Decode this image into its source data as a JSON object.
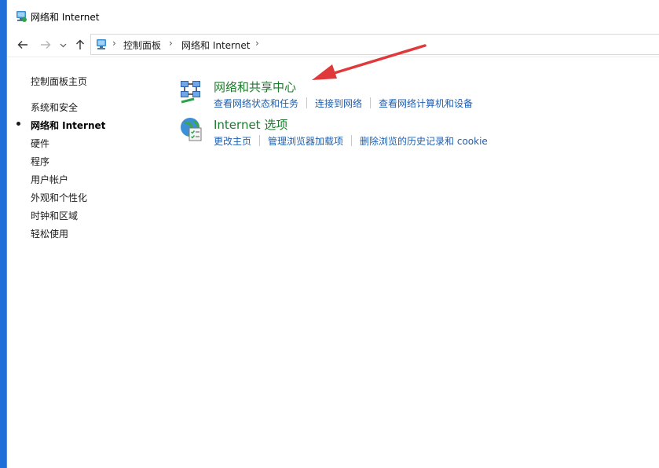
{
  "window": {
    "title": "网络和 Internet"
  },
  "nav": {
    "back_icon": "arrow-left-icon",
    "forward_icon": "arrow-right-icon",
    "recent_icon": "chevron-down-icon",
    "up_icon": "arrow-up-icon"
  },
  "breadcrumb": {
    "items": [
      "控制面板",
      "网络和 Internet"
    ]
  },
  "sidebar": {
    "home": "控制面板主页",
    "items": [
      {
        "label": "系统和安全",
        "active": false
      },
      {
        "label": "网络和 Internet",
        "active": true
      },
      {
        "label": "硬件",
        "active": false
      },
      {
        "label": "程序",
        "active": false
      },
      {
        "label": "用户帐户",
        "active": false
      },
      {
        "label": "外观和个性化",
        "active": false
      },
      {
        "label": "时钟和区域",
        "active": false
      },
      {
        "label": "轻松使用",
        "active": false
      }
    ]
  },
  "categories": [
    {
      "title": "网络和共享中心",
      "icon": "network-sharing-center-icon",
      "tasks": [
        "查看网络状态和任务",
        "连接到网络",
        "查看网络计算机和设备"
      ]
    },
    {
      "title": "Internet 选项",
      "icon": "internet-options-icon",
      "tasks": [
        "更改主页",
        "管理浏览器加载项",
        "删除浏览的历史记录和 cookie"
      ]
    }
  ],
  "colors": {
    "category_title": "#1c7c2c",
    "task_link": "#1f5fb0",
    "annotation_arrow": "#e0393b",
    "desktop": "#1e6fd9"
  }
}
